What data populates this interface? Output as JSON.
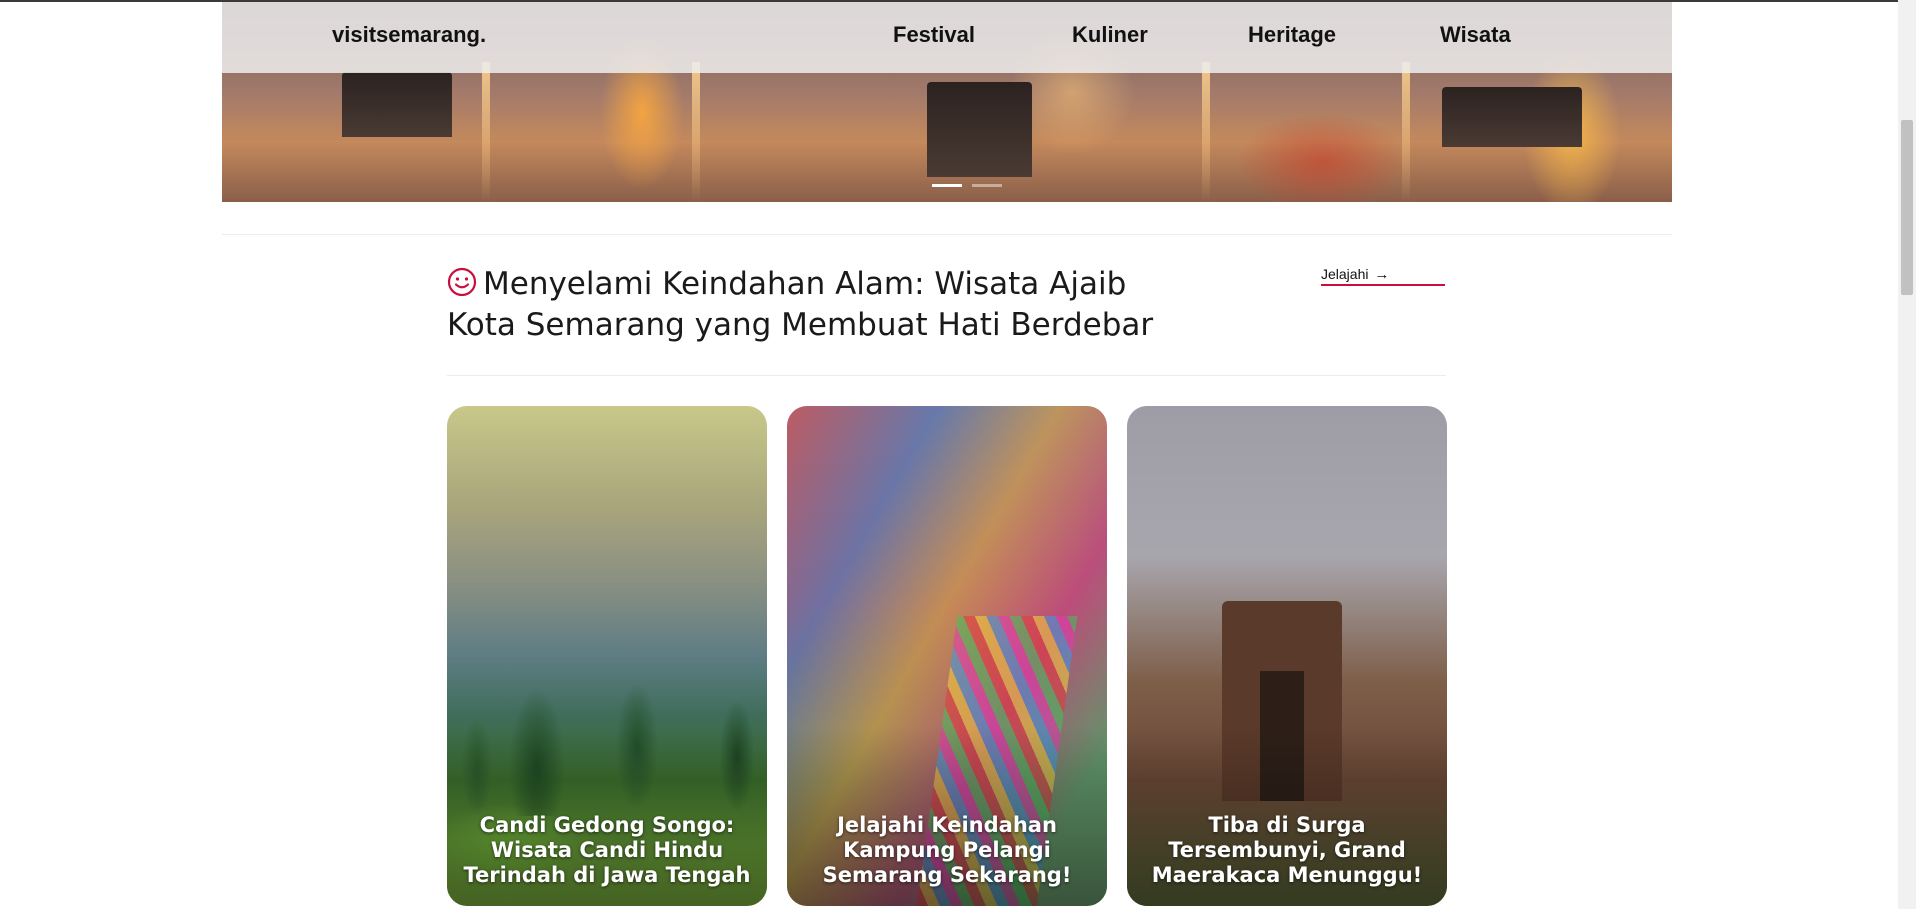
{
  "nav": {
    "brand": "visitsemarang.",
    "items": [
      {
        "label": "Festival"
      },
      {
        "label": "Kuliner"
      },
      {
        "label": "Heritage"
      },
      {
        "label": "Wisata"
      }
    ]
  },
  "hero": {
    "slide_count": 2,
    "active_slide": 1
  },
  "section": {
    "icon": "smile-icon",
    "title": "Menyelami Keindahan Alam: Wisata Ajaib Kota Semarang yang Membuat Hati Berdebar",
    "explore_label": "Jelajahi",
    "explore_icon": "arrow-right-icon",
    "accent_color": "#c8103e"
  },
  "cards": [
    {
      "caption": "Candi Gedong Songo: Wisata Candi Hindu Terindah di Jawa Tengah"
    },
    {
      "caption": "Jelajahi Keindahan Kampung Pelangi Semarang Sekarang!"
    },
    {
      "caption": "Tiba di Surga Tersembunyi, Grand Maerakaca Menunggu!"
    }
  ]
}
